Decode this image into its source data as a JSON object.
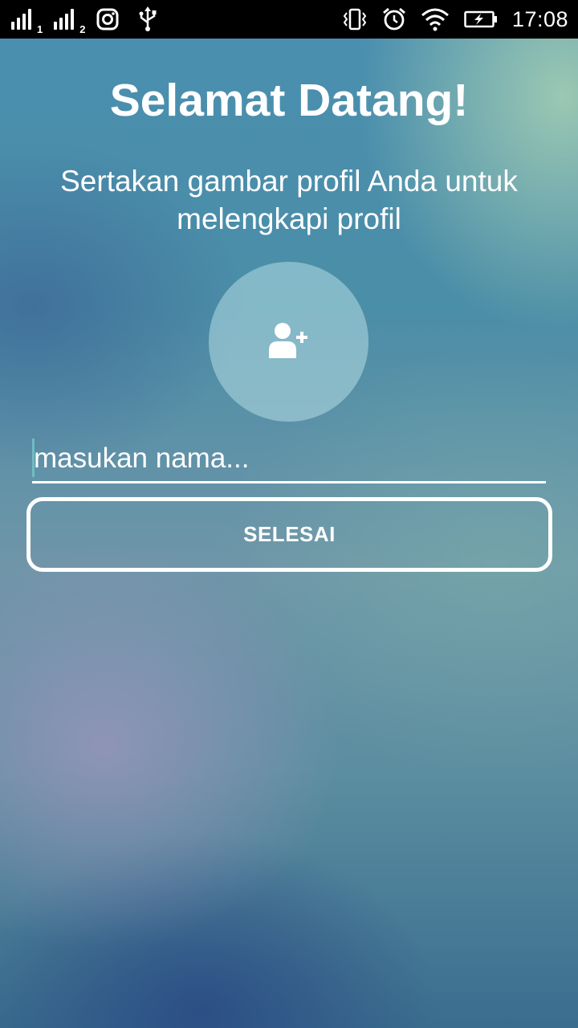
{
  "status_bar": {
    "sim1_label": "1",
    "sim2_label": "2",
    "time": "17:08",
    "icons": [
      "signal-sim1-icon",
      "signal-sim2-icon",
      "instagram-icon",
      "usb-icon",
      "vibrate-icon",
      "alarm-icon",
      "wifi-icon",
      "battery-charging-icon"
    ]
  },
  "page": {
    "title": "Selamat Datang!",
    "subtitle": "Sertakan gambar profil Anda untuk melengkapi profil"
  },
  "avatar": {
    "icon": "add-user-icon"
  },
  "name_input": {
    "value": "",
    "placeholder": "masukan nama..."
  },
  "done_button": {
    "label": "SELESAI"
  }
}
